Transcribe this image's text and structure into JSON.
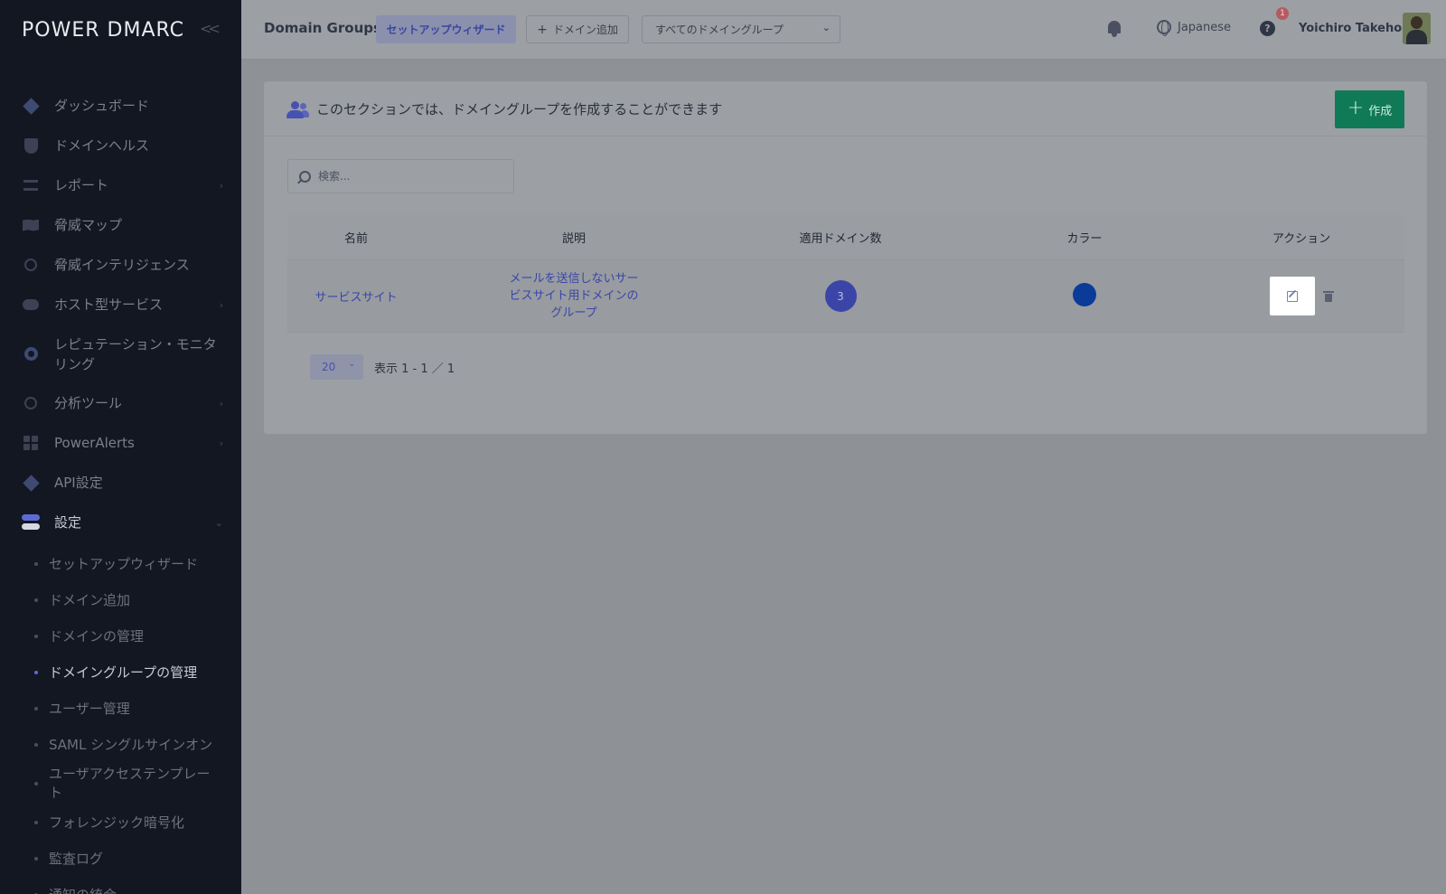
{
  "sidebar": {
    "logo": "POWER DMARC",
    "items": [
      {
        "label": "ダッシュボード",
        "icon": "dashboard-icon"
      },
      {
        "label": "ドメインヘルス",
        "icon": "shield-icon"
      },
      {
        "label": "レポート",
        "icon": "report-icon"
      },
      {
        "label": "脅威マップ",
        "icon": "map-icon"
      },
      {
        "label": "脅威インテリジェンス",
        "icon": "intel-icon"
      },
      {
        "label": "ホスト型サービス",
        "icon": "cloud-icon"
      },
      {
        "label": "レピュテーション・モニタリング",
        "icon": "reputation-icon"
      },
      {
        "label": "分析ツール",
        "icon": "analysis-icon"
      },
      {
        "label": "PowerAlerts",
        "icon": "alerts-icon"
      },
      {
        "label": "API設定",
        "icon": "api-icon"
      },
      {
        "label": "設定",
        "icon": "settings-icon"
      }
    ],
    "settings_sub": [
      "セットアップウィザード",
      "ドメイン追加",
      "ドメインの管理",
      "ドメイングループの管理",
      "ユーザー管理",
      "SAML シングルサインオン",
      "ユーザアクセステンプレート",
      "フォレンジック暗号化",
      "監査ログ",
      "通知の統合"
    ]
  },
  "header": {
    "title": "Domain Groups",
    "wizard_button": "セットアップウィザード",
    "add_domain_button": "ドメイン追加",
    "group_select": "すべてのドメイングループ",
    "language": "Japanese",
    "help_badge": "1",
    "username": "Yoichiro Takehora"
  },
  "card": {
    "title": "このセクションでは、ドメイングループを作成することができます",
    "create_button": "作成",
    "search_placeholder": "検索...",
    "table": {
      "headers": [
        "名前",
        "説明",
        "適用ドメイン数",
        "カラー",
        "アクション"
      ],
      "rows": [
        {
          "name": "サービスサイト",
          "description": "メールを送信しないサービスサイト用ドメインのグループ",
          "domain_count": "3",
          "color": "#0b3b98"
        }
      ]
    },
    "pager": {
      "per_page": "20",
      "info": "表示 1 - 1 ／ 1"
    }
  }
}
